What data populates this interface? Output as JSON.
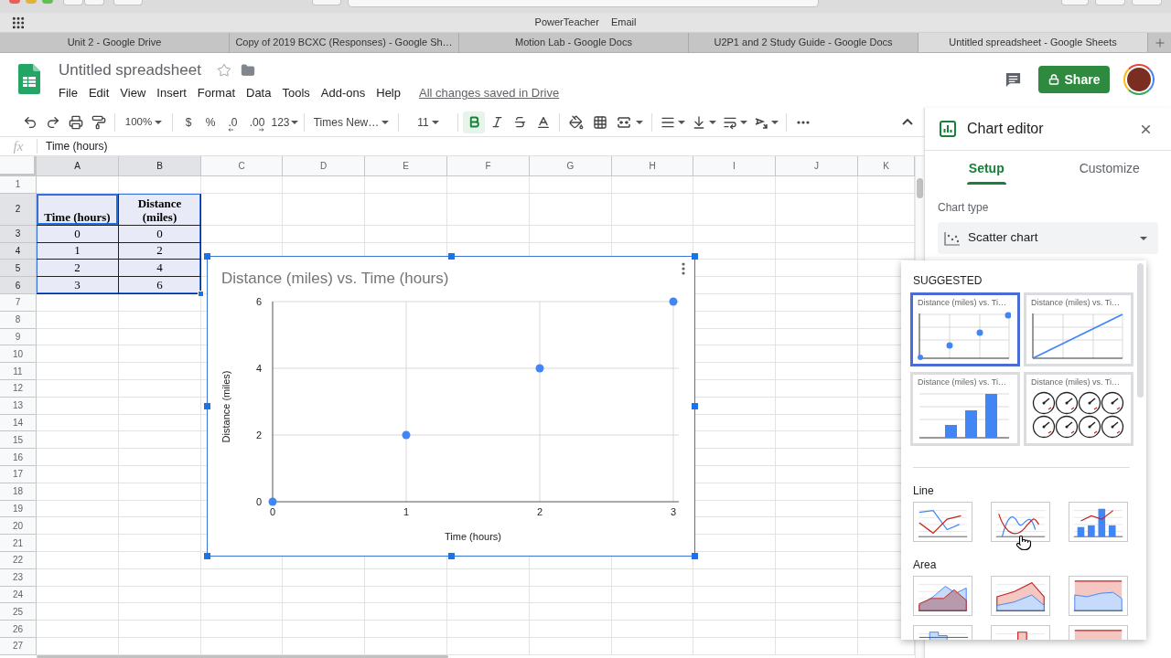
{
  "browser": {
    "bookmarks": [
      "PowerTeacher",
      "Email"
    ],
    "tabs": [
      {
        "label": "Unit 2 - Google Drive",
        "selected": false
      },
      {
        "label": "Copy of 2019 BCXC (Responses) - Google Sh…",
        "selected": false
      },
      {
        "label": "Motion Lab - Google Docs",
        "selected": false
      },
      {
        "label": "U2P1 and 2 Study Guide - Google Docs",
        "selected": false
      },
      {
        "label": "Untitled spreadsheet - Google Sheets",
        "selected": true
      }
    ]
  },
  "document": {
    "title": "Untitled spreadsheet",
    "starred": false,
    "menu": [
      "File",
      "Edit",
      "View",
      "Insert",
      "Format",
      "Data",
      "Tools",
      "Add-ons",
      "Help"
    ],
    "save_status": "All changes saved in Drive",
    "share_label": "Share"
  },
  "toolbar": {
    "zoom": "100%",
    "currency": "$",
    "percent": "%",
    "decimal_decrease": ".0",
    "decimal_increase": ".00",
    "number_format": "123",
    "font": "Times New…",
    "font_size": "11",
    "format_buttons": [
      {
        "kind": "bold",
        "active": true
      },
      {
        "kind": "italic",
        "active": false
      },
      {
        "kind": "strikethrough",
        "active": false
      }
    ]
  },
  "formula_bar": {
    "label": "fx",
    "value": "Time (hours)"
  },
  "sheet": {
    "columns": [
      {
        "label": "A",
        "selected": true
      },
      {
        "label": "B",
        "selected": true
      },
      {
        "label": "C",
        "selected": false
      },
      {
        "label": "D",
        "selected": false
      },
      {
        "label": "E",
        "selected": false
      },
      {
        "label": "F",
        "selected": false
      },
      {
        "label": "G",
        "selected": false
      },
      {
        "label": "H",
        "selected": false
      },
      {
        "label": "I",
        "selected": false
      },
      {
        "label": "J",
        "selected": false
      },
      {
        "label": "K",
        "selected": false
      }
    ],
    "rows": [
      {
        "label": "1",
        "kind": "blank",
        "selected": false
      },
      {
        "label": "2",
        "kind": "header",
        "selected": true,
        "cells": [
          {
            "value": "Time (hours)",
            "active": true
          },
          {
            "value": "Distance (miles)",
            "active": false
          }
        ]
      },
      {
        "label": "3",
        "kind": "data",
        "selected": true,
        "cells": [
          {
            "value": "0",
            "active": false
          },
          {
            "value": "0",
            "active": false
          }
        ]
      },
      {
        "label": "4",
        "kind": "data",
        "selected": true,
        "cells": [
          {
            "value": "1",
            "active": false
          },
          {
            "value": "2",
            "active": false
          }
        ]
      },
      {
        "label": "5",
        "kind": "data",
        "selected": true,
        "cells": [
          {
            "value": "2",
            "active": false
          },
          {
            "value": "4",
            "active": false
          }
        ]
      },
      {
        "label": "6",
        "kind": "data",
        "selected": true,
        "cells": [
          {
            "value": "3",
            "active": false
          },
          {
            "value": "6",
            "active": false
          }
        ]
      },
      {
        "label": "7",
        "kind": "blank",
        "selected": false
      },
      {
        "label": "8",
        "kind": "blank",
        "selected": false
      },
      {
        "label": "9",
        "kind": "blank",
        "selected": false
      },
      {
        "label": "10",
        "kind": "blank",
        "selected": false
      },
      {
        "label": "11",
        "kind": "blank",
        "selected": false
      },
      {
        "label": "12",
        "kind": "blank",
        "selected": false
      },
      {
        "label": "13",
        "kind": "blank",
        "selected": false
      },
      {
        "label": "14",
        "kind": "blank",
        "selected": false
      },
      {
        "label": "15",
        "kind": "blank",
        "selected": false
      },
      {
        "label": "16",
        "kind": "blank",
        "selected": false
      },
      {
        "label": "17",
        "kind": "blank",
        "selected": false
      },
      {
        "label": "18",
        "kind": "blank",
        "selected": false
      },
      {
        "label": "19",
        "kind": "blank",
        "selected": false
      },
      {
        "label": "20",
        "kind": "blank",
        "selected": false
      },
      {
        "label": "21",
        "kind": "blank",
        "selected": false
      },
      {
        "label": "22",
        "kind": "blank",
        "selected": false
      },
      {
        "label": "23",
        "kind": "blank",
        "selected": false
      },
      {
        "label": "24",
        "kind": "blank",
        "selected": false
      },
      {
        "label": "25",
        "kind": "blank",
        "selected": false
      },
      {
        "label": "26",
        "kind": "blank",
        "selected": false
      },
      {
        "label": "27",
        "kind": "blank",
        "selected": false
      }
    ]
  },
  "chart": {
    "selected": true,
    "chart_data": {
      "type": "scatter",
      "title": "Distance (miles) vs. Time (hours)",
      "xlabel": "Time (hours)",
      "ylabel": "Distance (miles)",
      "x": [
        0,
        1,
        2,
        3
      ],
      "series": [
        {
          "color": "#4285f4",
          "values": [
            0,
            2,
            4,
            6
          ]
        }
      ],
      "xlim": [
        0,
        3
      ],
      "ylim": [
        0,
        6
      ],
      "xticks": [
        0,
        1,
        2,
        3
      ],
      "yticks": [
        0,
        2,
        4,
        6
      ],
      "grid": true
    }
  },
  "chart_editor": {
    "title": "Chart editor",
    "tabs": [
      {
        "label": "Setup",
        "selected": true
      },
      {
        "label": "Customize",
        "selected": false
      }
    ],
    "chart_type": {
      "label": "Chart type",
      "value": "Scatter chart"
    },
    "picker": {
      "sections": [
        {
          "heading": "SUGGESTED",
          "items": [
            {
              "kind": "scatter",
              "title": "Distance (miles) vs. Ti…",
              "selected": true
            },
            {
              "kind": "line",
              "title": "Distance (miles) vs. Ti…",
              "selected": false
            },
            {
              "kind": "column",
              "title": "Distance (miles) vs. Ti…",
              "selected": false
            },
            {
              "kind": "gauge",
              "title": "Distance (miles) vs. Ti…",
              "selected": false
            }
          ]
        },
        {
          "heading": "Line",
          "items": [
            {
              "kind": "line",
              "selected": false
            },
            {
              "kind": "smooth_line",
              "selected": false
            },
            {
              "kind": "combo",
              "selected": false
            }
          ]
        },
        {
          "heading": "Area",
          "items": [
            {
              "kind": "area",
              "selected": false
            },
            {
              "kind": "stacked_area",
              "selected": false
            },
            {
              "kind": "percent_area",
              "selected": false
            },
            {
              "kind": "stepped_area",
              "selected": false
            },
            {
              "kind": "stacked_stepped_area",
              "selected": false
            },
            {
              "kind": "percent_stepped_area",
              "selected": false
            }
          ]
        }
      ]
    }
  }
}
